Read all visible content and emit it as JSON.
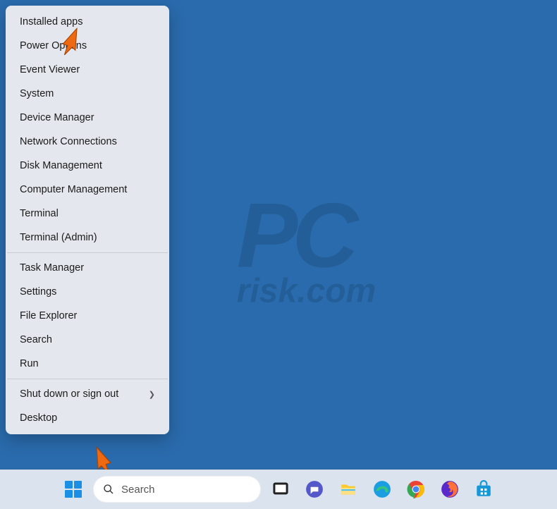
{
  "watermark": {
    "logo": "PC",
    "text": "risk.com"
  },
  "context_menu": {
    "groups": [
      {
        "items": [
          {
            "label": "Installed apps",
            "id": "installed-apps"
          },
          {
            "label": "Power Options",
            "id": "power-options"
          },
          {
            "label": "Event Viewer",
            "id": "event-viewer"
          },
          {
            "label": "System",
            "id": "system"
          },
          {
            "label": "Device Manager",
            "id": "device-manager"
          },
          {
            "label": "Network Connections",
            "id": "network-connections"
          },
          {
            "label": "Disk Management",
            "id": "disk-management"
          },
          {
            "label": "Computer Management",
            "id": "computer-management"
          },
          {
            "label": "Terminal",
            "id": "terminal"
          },
          {
            "label": "Terminal (Admin)",
            "id": "terminal-admin"
          }
        ]
      },
      {
        "items": [
          {
            "label": "Task Manager",
            "id": "task-manager"
          },
          {
            "label": "Settings",
            "id": "settings"
          },
          {
            "label": "File Explorer",
            "id": "file-explorer"
          },
          {
            "label": "Search",
            "id": "search"
          },
          {
            "label": "Run",
            "id": "run"
          }
        ]
      },
      {
        "items": [
          {
            "label": "Shut down or sign out",
            "id": "shutdown",
            "submenu": true
          },
          {
            "label": "Desktop",
            "id": "desktop"
          }
        ]
      }
    ]
  },
  "taskbar": {
    "search_placeholder": "Search",
    "icons": [
      {
        "name": "task-view-icon"
      },
      {
        "name": "chat-icon"
      },
      {
        "name": "file-explorer-icon"
      },
      {
        "name": "edge-icon"
      },
      {
        "name": "chrome-icon"
      },
      {
        "name": "firefox-icon"
      },
      {
        "name": "store-icon"
      }
    ]
  }
}
